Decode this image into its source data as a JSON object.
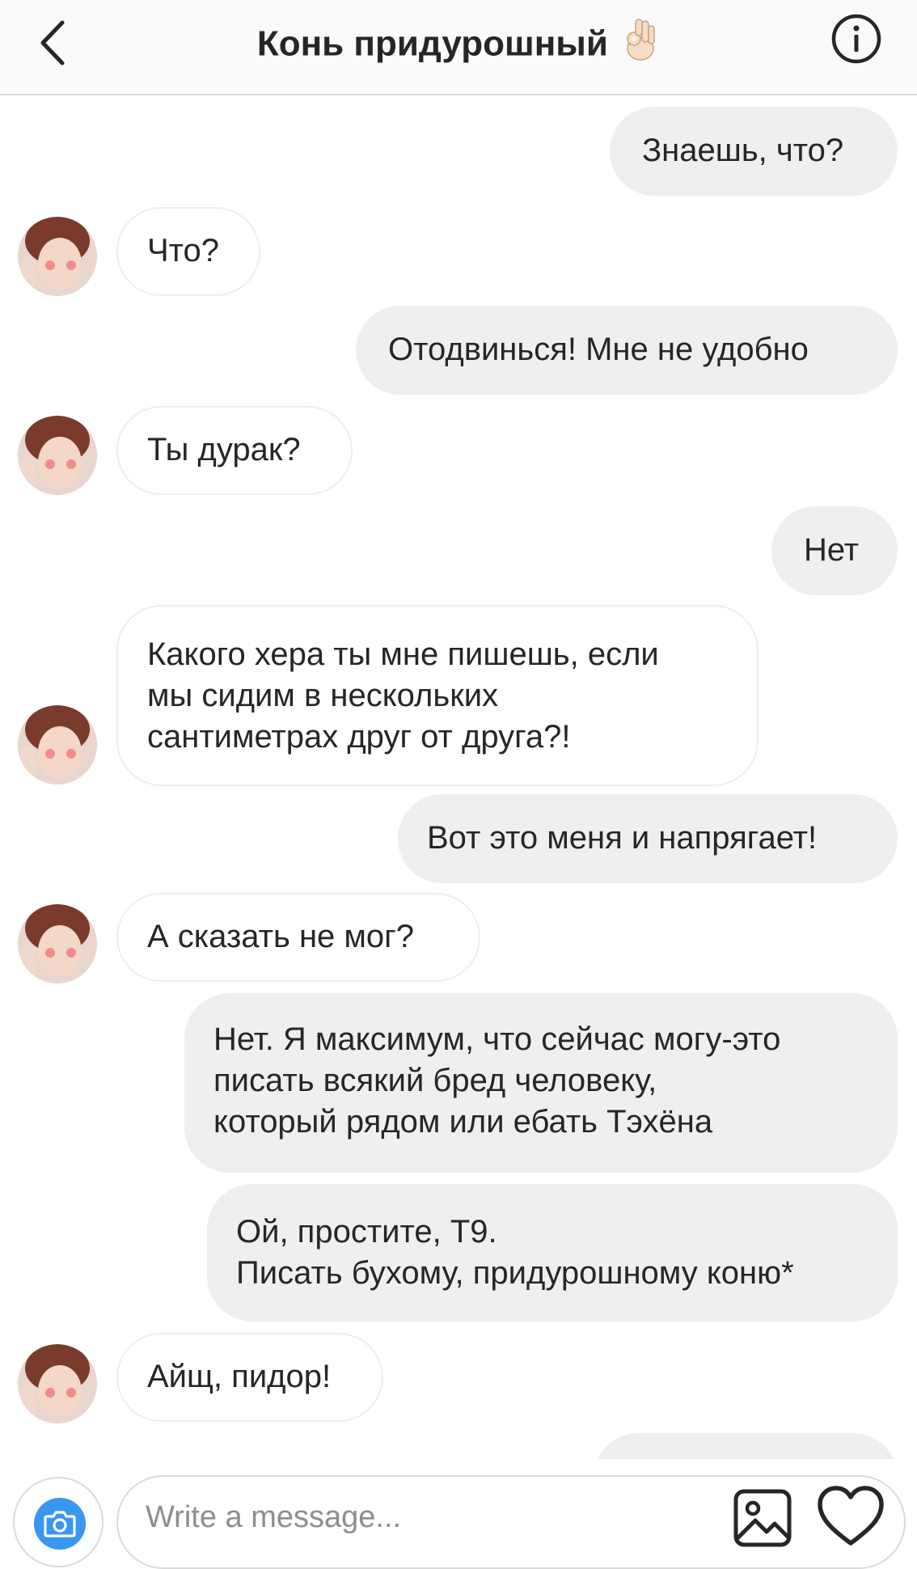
{
  "header": {
    "title": "Конь придурошный",
    "title_emoji": "ok-hand-emoji",
    "back_icon": "chevron-left-icon",
    "info_icon": "info-icon"
  },
  "messages": [
    {
      "side": "out",
      "text": "Знаешь, что?"
    },
    {
      "side": "in",
      "text": "Что?"
    },
    {
      "side": "out",
      "text": "Отодвинься! Мне не удобно"
    },
    {
      "side": "in",
      "text": "Ты дурак?"
    },
    {
      "side": "out",
      "text": "Нет"
    },
    {
      "side": "in",
      "text": "Какого хера ты мне пишешь, если\nмы сидим в нескольких\nсантиметрах друг от друга?!"
    },
    {
      "side": "out",
      "text": "Вот это меня и напрягает!"
    },
    {
      "side": "in",
      "text": "А сказать не мог?"
    },
    {
      "side": "out",
      "text": "Нет. Я максимум, что сейчас могу-это\nписать всякий бред человеку,\nкоторый рядом или ебать Тэхёна"
    },
    {
      "side": "out",
      "text": "Ой, простите, Т9.\nПисать бухому, придурошному коню*"
    },
    {
      "side": "in",
      "text": "Айщ, пидор!"
    }
  ],
  "composer": {
    "placeholder": "Write a message...",
    "value": "",
    "camera_icon": "camera-icon",
    "gallery_icon": "image-icon",
    "like_icon": "heart-icon"
  },
  "colors": {
    "outgoing_bubble": "#efefef",
    "incoming_border": "#efefef",
    "accent": "#3897f0",
    "text": "#262626",
    "placeholder": "#8e8e8e"
  }
}
